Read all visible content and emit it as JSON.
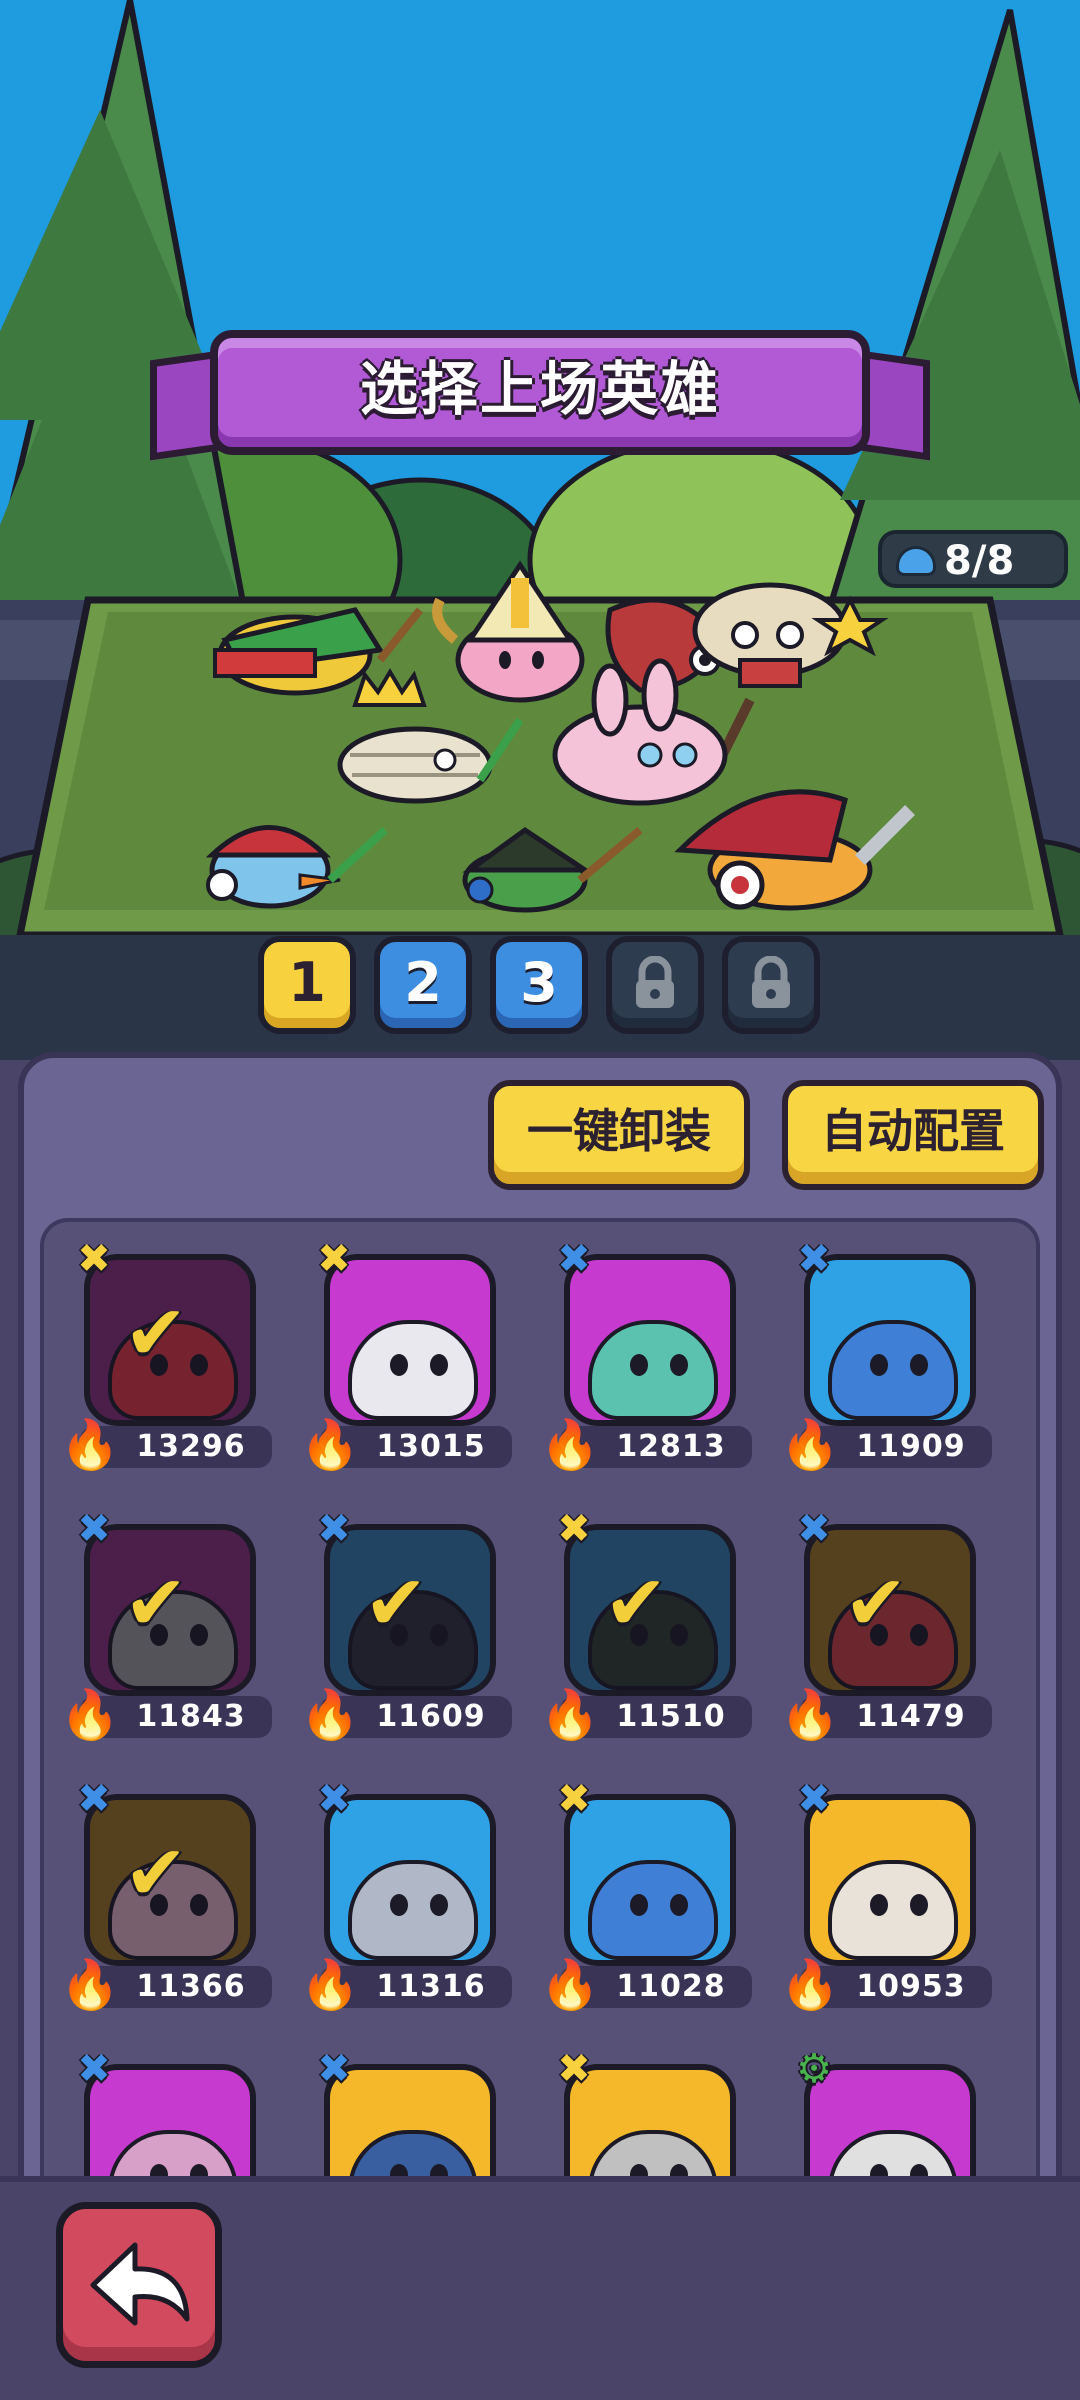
{
  "header": {
    "title": "选择上场英雄",
    "slot_count": "8/8"
  },
  "formation_tabs": [
    {
      "label": "1",
      "state": "active"
    },
    {
      "label": "2",
      "state": "normal"
    },
    {
      "label": "3",
      "state": "normal"
    },
    {
      "label": "",
      "state": "locked",
      "icon": "lock-icon"
    },
    {
      "label": "",
      "state": "locked",
      "icon": "lock-icon"
    }
  ],
  "actions": {
    "unequip_all": "一键卸装",
    "auto_config": "自动配置"
  },
  "heroes": [
    {
      "power": "13296",
      "selected": true,
      "class_icon": "yellow-crossbones-icon",
      "bg": "#7a2d6e"
    },
    {
      "power": "13015",
      "selected": false,
      "class_icon": "yellow-crossbones-icon",
      "bg": "#c63ad0"
    },
    {
      "power": "12813",
      "selected": false,
      "class_icon": "blue-crossbones-icon",
      "bg": "#c63ad0"
    },
    {
      "power": "11909",
      "selected": false,
      "class_icon": "blue-crossbones-icon",
      "bg": "#2fa2e6"
    },
    {
      "power": "11843",
      "selected": true,
      "class_icon": "blue-crossbones-icon",
      "bg": "#7a2d6e"
    },
    {
      "power": "11609",
      "selected": true,
      "class_icon": "blue-crossbones-icon",
      "bg": "#2a6f9a"
    },
    {
      "power": "11510",
      "selected": true,
      "class_icon": "yellow-crossbones-icon",
      "bg": "#2a6f9a"
    },
    {
      "power": "11479",
      "selected": true,
      "class_icon": "blue-crossbones-icon",
      "bg": "#8c6a1f"
    },
    {
      "power": "11366",
      "selected": true,
      "class_icon": "blue-crossbones-icon",
      "bg": "#8c6a1f"
    },
    {
      "power": "11316",
      "selected": false,
      "class_icon": "blue-crossbones-icon",
      "bg": "#2fa2e6"
    },
    {
      "power": "11028",
      "selected": false,
      "class_icon": "yellow-crossbones-icon",
      "bg": "#2fa2e6"
    },
    {
      "power": "10953",
      "selected": false,
      "class_icon": "blue-crossbones-icon",
      "bg": "#f5b82a"
    },
    {
      "power": "",
      "selected": false,
      "class_icon": "blue-crossbones-icon",
      "bg": "#c63ad0"
    },
    {
      "power": "",
      "selected": false,
      "class_icon": "blue-crossbones-icon",
      "bg": "#f5b82a"
    },
    {
      "power": "",
      "selected": false,
      "class_icon": "yellow-crossbones-icon",
      "bg": "#f5b82a"
    },
    {
      "power": "",
      "selected": false,
      "class_icon": "green-gear-icon",
      "bg": "#c63ad0"
    }
  ],
  "colors": {
    "accent_yellow": "#f7d13e",
    "accent_purple": "#b25ad6",
    "panel": "#6a6592",
    "back_button": "#d24a5e"
  },
  "icons": {
    "back": "back-arrow-icon",
    "flame": "flame-icon",
    "check": "checkmark-icon"
  }
}
